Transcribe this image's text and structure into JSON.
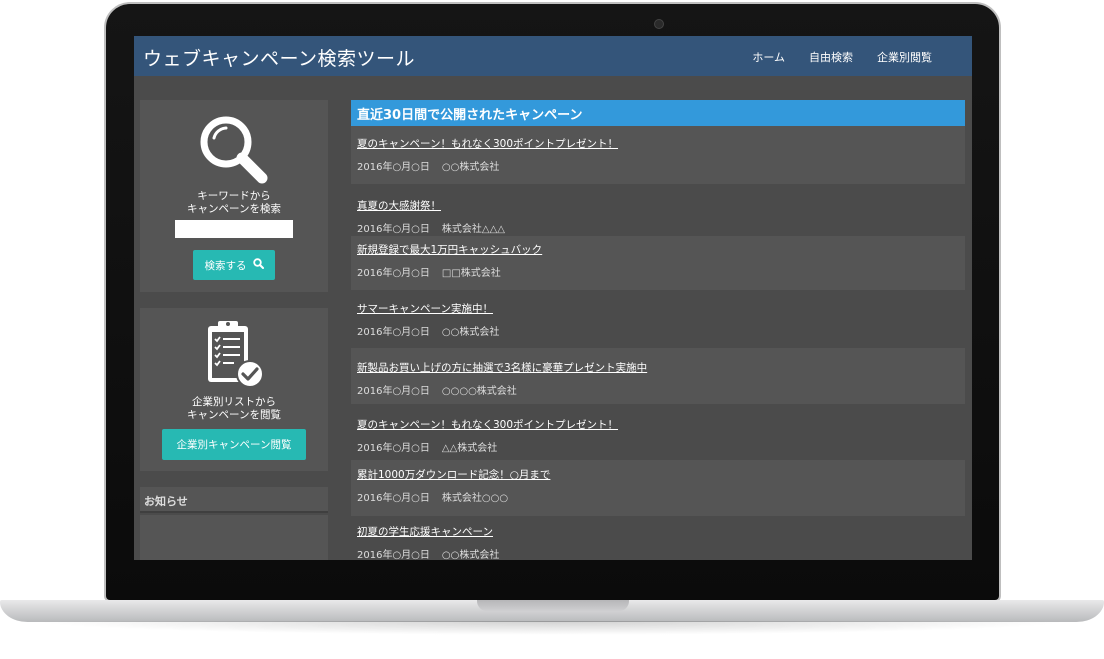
{
  "header": {
    "title": "ウェブキャンペーン検索ツール",
    "nav": [
      "ホーム",
      "自由検索",
      "企業別閲覧"
    ]
  },
  "sidebar": {
    "search": {
      "label": "キーワードから\nキャンペーンを検索",
      "input_value": "",
      "button_label": "検索する"
    },
    "company": {
      "label": "企業別リストから\nキャンペーンを閲覧",
      "button_label": "企業別キャンペーン閲覧"
    },
    "news": {
      "heading": "お知らせ"
    }
  },
  "main": {
    "heading": "直近30日間で公開されたキャンペーン",
    "campaigns": [
      {
        "title": "夏のキャンペーン！もれなく300ポイントプレゼント！",
        "date": "2016年○月○日",
        "company": "○○株式会社"
      },
      {
        "title": "真夏の大感謝祭！",
        "date": "2016年○月○日",
        "company": "株式会社△△△"
      },
      {
        "title": "新規登録で最大1万円キャッシュバック",
        "date": "2016年○月○日",
        "company": "□□株式会社"
      },
      {
        "title": "サマーキャンペーン実施中！",
        "date": "2016年○月○日",
        "company": "○○株式会社"
      },
      {
        "title": "新製品お買い上げの方に抽選で3名様に豪華プレゼント実施中",
        "date": "2016年○月○日",
        "company": "○○○○株式会社"
      },
      {
        "title": "夏のキャンペーン！もれなく300ポイントプレゼント！",
        "date": "2016年○月○日",
        "company": "△△株式会社"
      },
      {
        "title": "累計1000万ダウンロード記念！○月まで",
        "date": "2016年○月○日",
        "company": "株式会社○○○"
      },
      {
        "title": "初夏の学生応援キャンペーン",
        "date": "2016年○月○日",
        "company": "○○株式会社"
      }
    ]
  },
  "colors": {
    "header_bg": "#34557a",
    "section_heading_bg": "#3399db",
    "accent_button": "#27b9b3",
    "screen_bg": "#4b4b4b"
  },
  "icons": [
    "magnifier-icon",
    "clipboard-check-icon",
    "search-icon"
  ]
}
